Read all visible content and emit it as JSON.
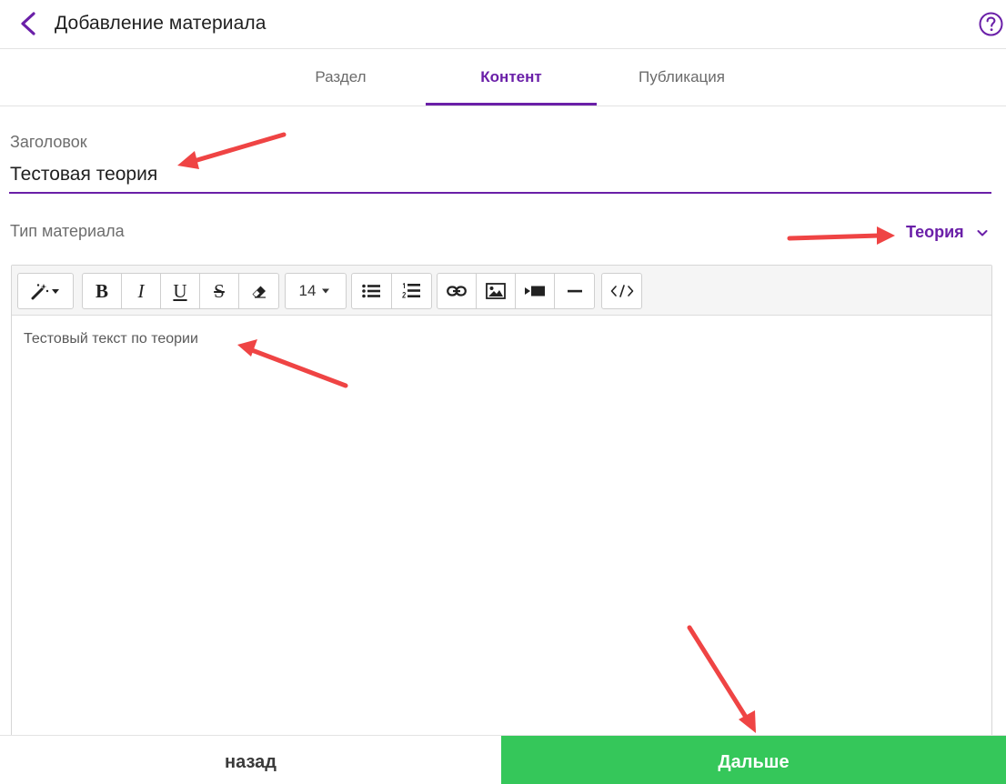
{
  "header": {
    "title": "Добавление материала"
  },
  "tabs": [
    {
      "label": "Раздел",
      "active": false
    },
    {
      "label": "Контент",
      "active": true
    },
    {
      "label": "Публикация",
      "active": false
    }
  ],
  "form": {
    "title_label": "Заголовок",
    "title_value": "Тестовая теория",
    "type_label": "Тип материала",
    "type_value": "Теория"
  },
  "editor": {
    "font_size": "14",
    "body_text": "Тестовый текст по теории",
    "toolbar_icons": [
      "magic-wand-icon",
      "bold-icon",
      "italic-icon",
      "underline-icon",
      "strikethrough-icon",
      "eraser-icon",
      "font-size-dropdown",
      "bullet-list-icon",
      "numbered-list-icon",
      "link-icon",
      "image-icon",
      "video-icon",
      "horizontal-rule-icon",
      "code-view-icon"
    ]
  },
  "footer": {
    "back_label": "назад",
    "next_label": "Дальше"
  },
  "colors": {
    "accent": "#6a1fa8",
    "next_button": "#35c75a",
    "annotation_arrow": "#ef4444"
  }
}
